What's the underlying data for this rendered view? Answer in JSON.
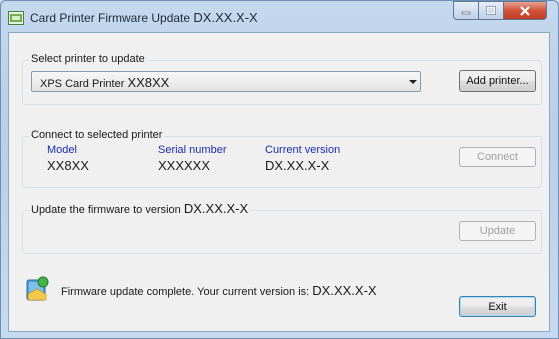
{
  "window": {
    "title": "Card Printer Firmware Update",
    "title_version": "DX.XX.X-X",
    "caption_buttons": [
      "minimize-icon",
      "maximize-icon",
      "close-icon"
    ]
  },
  "select_section": {
    "legend": "Select printer to update",
    "printer_name": "XPS Card Printer",
    "printer_model": "XX8XX",
    "add_printer_label": "Add printer..."
  },
  "connect_section": {
    "legend": "Connect to selected printer",
    "model_label": "Model",
    "model_value": "XX8XX",
    "serial_label": "Serial number",
    "serial_value": "XXXXXX",
    "current_version_label": "Current version",
    "current_version_value": "DX.XX.X-X",
    "connect_label": "Connect"
  },
  "update_section": {
    "legend": "Update the firmware to version",
    "legend_version": "DX.XX.X-X",
    "update_label": "Update"
  },
  "status": {
    "message": "Firmware update complete. Your current version is:",
    "version": "DX.XX.X-X",
    "icon": "shield-icon"
  },
  "exit_label": "Exit",
  "colors": {
    "label_blue": "#1c2bb0",
    "close_red": "#c13b22",
    "frame": "#c4d8ee"
  }
}
